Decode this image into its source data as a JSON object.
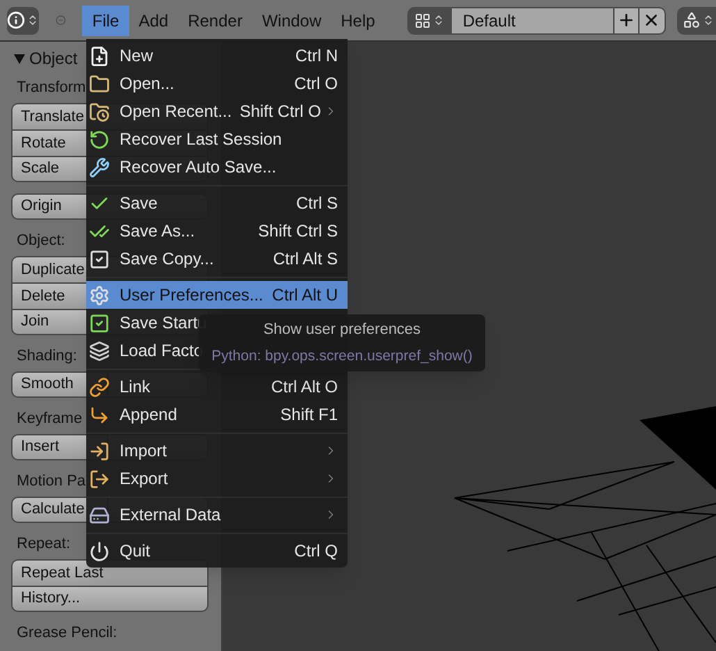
{
  "header": {
    "menus": [
      {
        "label": "File",
        "selected": true
      },
      {
        "label": "Add",
        "selected": false
      },
      {
        "label": "Render",
        "selected": false
      },
      {
        "label": "Window",
        "selected": false
      },
      {
        "label": "Help",
        "selected": false
      }
    ],
    "layout": {
      "value": "Default"
    }
  },
  "tool_panel": {
    "title": "Object",
    "groups": [
      {
        "kind": "label",
        "text": "Transform"
      },
      {
        "kind": "stack",
        "buttons": [
          "Translate",
          "Rotate",
          "Scale"
        ]
      },
      {
        "kind": "stack",
        "buttons": [
          "Origin"
        ]
      },
      {
        "kind": "label",
        "text": "Object:"
      },
      {
        "kind": "stack",
        "buttons": [
          "Duplicate",
          "Delete",
          "Join"
        ]
      },
      {
        "kind": "label",
        "text": "Shading:"
      },
      {
        "kind": "pair",
        "buttons": [
          "Smooth"
        ]
      },
      {
        "kind": "label",
        "text": "Keyframe"
      },
      {
        "kind": "pair",
        "buttons": [
          "Insert"
        ]
      },
      {
        "kind": "label",
        "text": "Motion Pa"
      },
      {
        "kind": "pair",
        "buttons": [
          "Calculate"
        ]
      },
      {
        "kind": "label",
        "text": "Repeat:"
      },
      {
        "kind": "stack",
        "buttons": [
          "Repeat Last",
          "History..."
        ]
      },
      {
        "kind": "label",
        "text": "Grease Pencil:"
      }
    ]
  },
  "file_menu": {
    "items": [
      {
        "kind": "item",
        "label": "New",
        "shortcut": "Ctrl N",
        "submenu": false,
        "selected": false
      },
      {
        "kind": "item",
        "label": "Open...",
        "shortcut": "Ctrl O",
        "submenu": false,
        "selected": false
      },
      {
        "kind": "item",
        "label": "Open Recent...",
        "shortcut": "Shift Ctrl O",
        "submenu": true,
        "selected": false
      },
      {
        "kind": "item",
        "label": "Recover Last Session",
        "submenu": false,
        "selected": false
      },
      {
        "kind": "item",
        "label": "Recover Auto Save...",
        "submenu": false,
        "selected": false
      },
      {
        "kind": "separator"
      },
      {
        "kind": "item",
        "label": "Save",
        "shortcut": "Ctrl S",
        "submenu": false,
        "selected": false
      },
      {
        "kind": "item",
        "label": "Save As...",
        "shortcut": "Shift Ctrl S",
        "submenu": false,
        "selected": false
      },
      {
        "kind": "item",
        "label": "Save Copy...",
        "shortcut": "Ctrl Alt S",
        "submenu": false,
        "selected": false
      },
      {
        "kind": "separator"
      },
      {
        "kind": "item",
        "label": "User Preferences...",
        "shortcut": "Ctrl Alt U",
        "submenu": false,
        "selected": true
      },
      {
        "kind": "item",
        "label": "Save Startu",
        "selected": false
      },
      {
        "kind": "item",
        "label": "Load Facto",
        "selected": false
      },
      {
        "kind": "separator"
      },
      {
        "kind": "item",
        "label": "Link",
        "shortcut": "Ctrl Alt O",
        "submenu": false,
        "selected": false
      },
      {
        "kind": "item",
        "label": "Append",
        "shortcut": "Shift F1",
        "submenu": false,
        "selected": false
      },
      {
        "kind": "separator"
      },
      {
        "kind": "item",
        "label": "Import",
        "submenu": true,
        "selected": false
      },
      {
        "kind": "item",
        "label": "Export",
        "submenu": true,
        "selected": false
      },
      {
        "kind": "separator"
      },
      {
        "kind": "item",
        "label": "External Data",
        "submenu": true,
        "selected": false
      },
      {
        "kind": "separator"
      },
      {
        "kind": "item",
        "label": "Quit",
        "shortcut": "Ctrl Q",
        "submenu": false,
        "selected": false
      }
    ]
  },
  "tooltip": {
    "text": "Show user preferences",
    "python": "Python: bpy.ops.screen.userpref_show()"
  }
}
